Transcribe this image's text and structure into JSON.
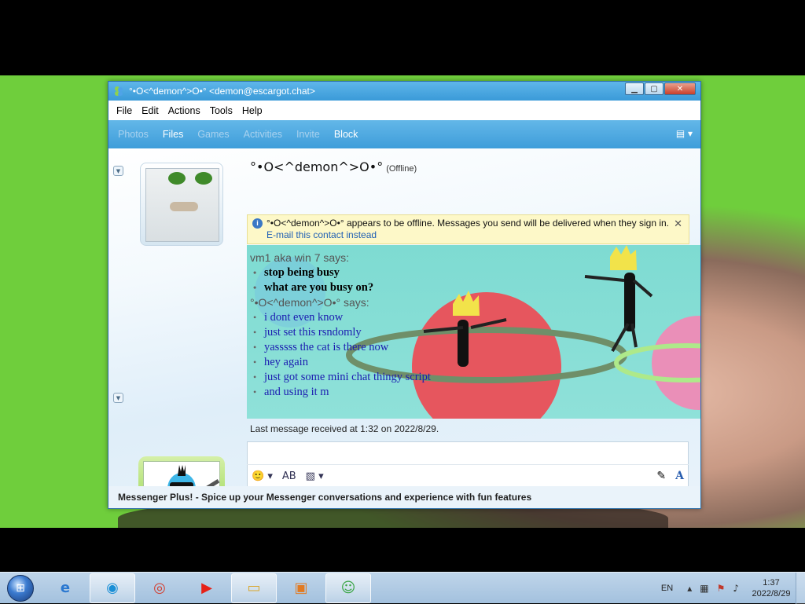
{
  "window": {
    "title": "°•O<^demon^>O•° <demon@escargot.chat>",
    "buttons": {
      "minimize": "▁",
      "maximize": "▢",
      "close": "✕"
    }
  },
  "menu": [
    "File",
    "Edit",
    "Actions",
    "Tools",
    "Help"
  ],
  "toolbar": {
    "items": [
      {
        "label": "Photos",
        "enabled": false
      },
      {
        "label": "Files",
        "enabled": true
      },
      {
        "label": "Games",
        "enabled": false
      },
      {
        "label": "Activities",
        "enabled": false
      },
      {
        "label": "Invite",
        "enabled": false
      },
      {
        "label": "Block",
        "enabled": true
      }
    ],
    "share_icon": "share-icon"
  },
  "contact": {
    "name": "°•O<^demon^>O•°",
    "status": "(Offline)"
  },
  "infobar": {
    "message": "°•O<^demon^>O•° appears to be offline. Messages you send will be delivered when they sign in.",
    "link": "E-mail this contact instead",
    "close": "✕"
  },
  "conversation": [
    {
      "speaker": "vm1 aka win 7 says:",
      "who": "me",
      "messages": [
        "stop being busy",
        "what are you busy on?"
      ]
    },
    {
      "speaker": "°•O<^demon^>O•° says:",
      "who": "them",
      "messages": [
        "i dont even know",
        "just set this rsndomly",
        "yasssss the cat is there now",
        "hey again",
        "just got some mini chat thingy script",
        "and using it m"
      ]
    }
  ],
  "last_message": "Last message received at 1:32 on 2022/8/29.",
  "input": {
    "emoticon": "🙂",
    "text_format": "A",
    "spell": "AB"
  },
  "plus_bar": "Messenger Plus! - Spice up your Messenger conversations and experience with fun features",
  "taskbar": {
    "language": "EN",
    "time": "1:37",
    "date": "2022/8/29"
  }
}
